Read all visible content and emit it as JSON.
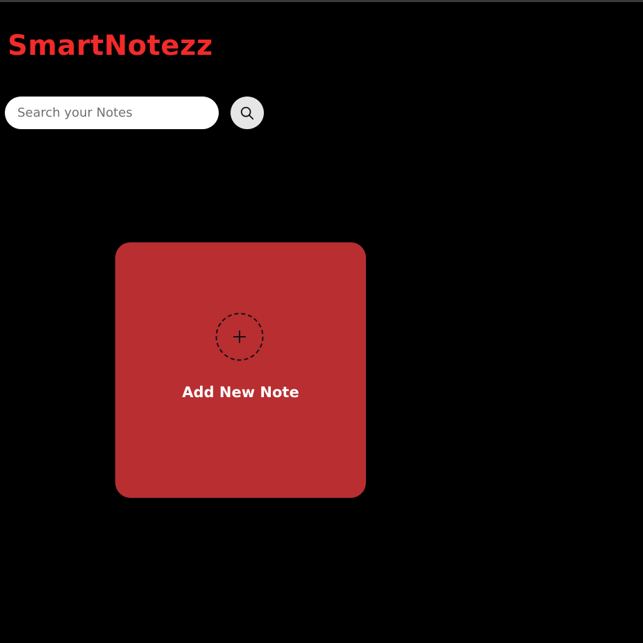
{
  "app": {
    "title": "SmartNotezz",
    "title_color": "#f32a2a"
  },
  "search": {
    "placeholder": "Search your Notes",
    "value": "",
    "button_icon": "search-icon"
  },
  "add_note_card": {
    "icon": "plus-icon",
    "label": "Add New Note",
    "color": "#b82e31"
  },
  "colors": {
    "background": "#000000",
    "accent": "#f32a2a",
    "card": "#b82e31"
  }
}
